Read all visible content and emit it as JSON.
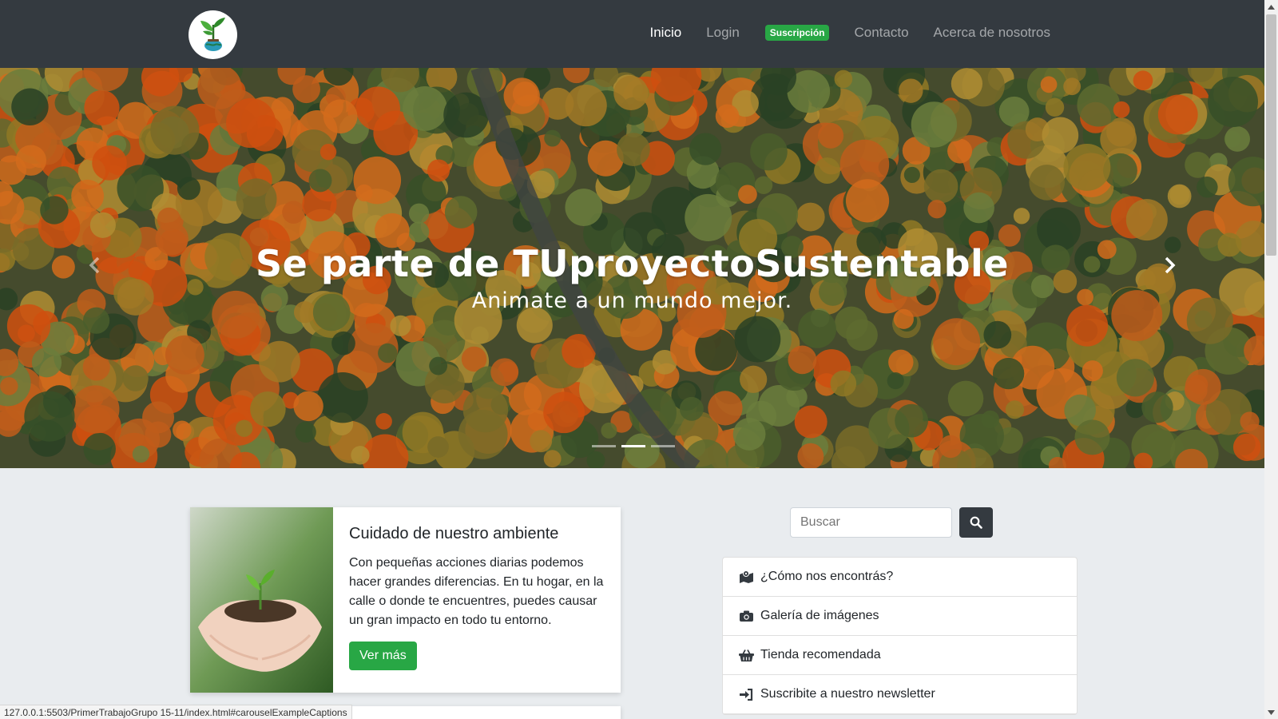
{
  "navbar": {
    "logo_icon": "plant-globe-logo",
    "items": [
      {
        "label": "Inicio",
        "active": true
      },
      {
        "label": "Login",
        "active": false
      },
      {
        "label": "Suscripción",
        "badge": true
      },
      {
        "label": "Contacto",
        "active": false
      },
      {
        "label": "Acerca de nosotros",
        "active": false
      }
    ]
  },
  "carousel": {
    "title": "Se parte de TUproyectoSustentable",
    "subtitle": "Animate a un mundo mejor.",
    "prev_icon": "chevron-left-icon",
    "next_icon": "chevron-right-icon",
    "slide_count": 3,
    "active_slide": 2
  },
  "card": {
    "title": "Cuidado de nuestro ambiente",
    "text": "Con pequeñas acciones diarias podemos hacer grandes diferencias. En tu hogar, en la calle o donde te encuentres, puedes causar un gran impacto en todo tu entorno.",
    "button": "Ver más"
  },
  "search": {
    "placeholder": "Buscar",
    "icon": "search-icon"
  },
  "sidebar_list": [
    {
      "label": "¿Cómo nos encontrás?",
      "icon": "map-marked-icon"
    },
    {
      "label": "Galería de imágenes",
      "icon": "camera-icon"
    },
    {
      "label": "Tienda recomendada",
      "icon": "shopping-basket-icon"
    },
    {
      "label": "Suscribite a nuestro newsletter",
      "icon": "sign-in-icon"
    }
  ],
  "status_bar": "127.0.0.1:5503/PrimerTrabajoGrupo 15-11/index.html#carouselExampleCaptions",
  "colors": {
    "navbar_bg": "#343a40",
    "accent_green": "#28a745",
    "page_bg": "#e9ecef"
  }
}
